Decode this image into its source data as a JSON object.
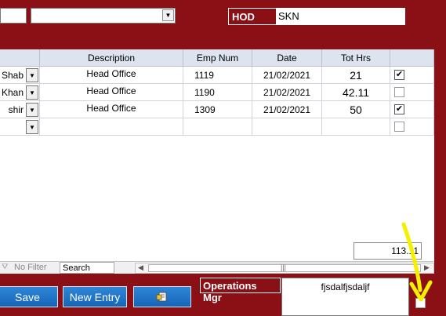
{
  "top": {
    "field1_value": "",
    "field2_value": "",
    "hod_label": "HOD",
    "hod_value": "SKN"
  },
  "grid": {
    "columns": [
      "",
      "Description",
      "Emp Num",
      "Date",
      "Tot Hrs",
      ""
    ],
    "rows": [
      {
        "name": "Shab",
        "description": "Head Office",
        "emp_num": "1119",
        "date": "21/02/2021",
        "tot_hrs": "21",
        "checked": true
      },
      {
        "name": "Khan",
        "description": "Head Office",
        "emp_num": "1190",
        "date": "21/02/2021",
        "tot_hrs": "42.11",
        "checked": false
      },
      {
        "name": "shir",
        "description": "Head Office",
        "emp_num": "1309",
        "date": "21/02/2021",
        "tot_hrs": "50",
        "checked": true
      },
      {
        "name": "",
        "description": "",
        "emp_num": "",
        "date": "",
        "tot_hrs": "",
        "checked": false
      }
    ],
    "total_value": "113.11"
  },
  "navbar": {
    "filter_label": "No Filter",
    "search_text": "Search"
  },
  "buttons": {
    "save_label": "Save",
    "new_entry_label": "New Entry"
  },
  "ops": {
    "label": "Operations Mgr",
    "value": "fjsdalfjsdaljf"
  },
  "colors": {
    "background": "#8b1016",
    "button": "#1f74c8",
    "annotation_arrow": "#f5f000"
  },
  "icons": {
    "dropdown": "chevron-down-icon",
    "checkmark": "check-icon",
    "filter": "no-filter-icon",
    "export": "export-report-icon",
    "annotation": "yellow-arrow-icon"
  }
}
